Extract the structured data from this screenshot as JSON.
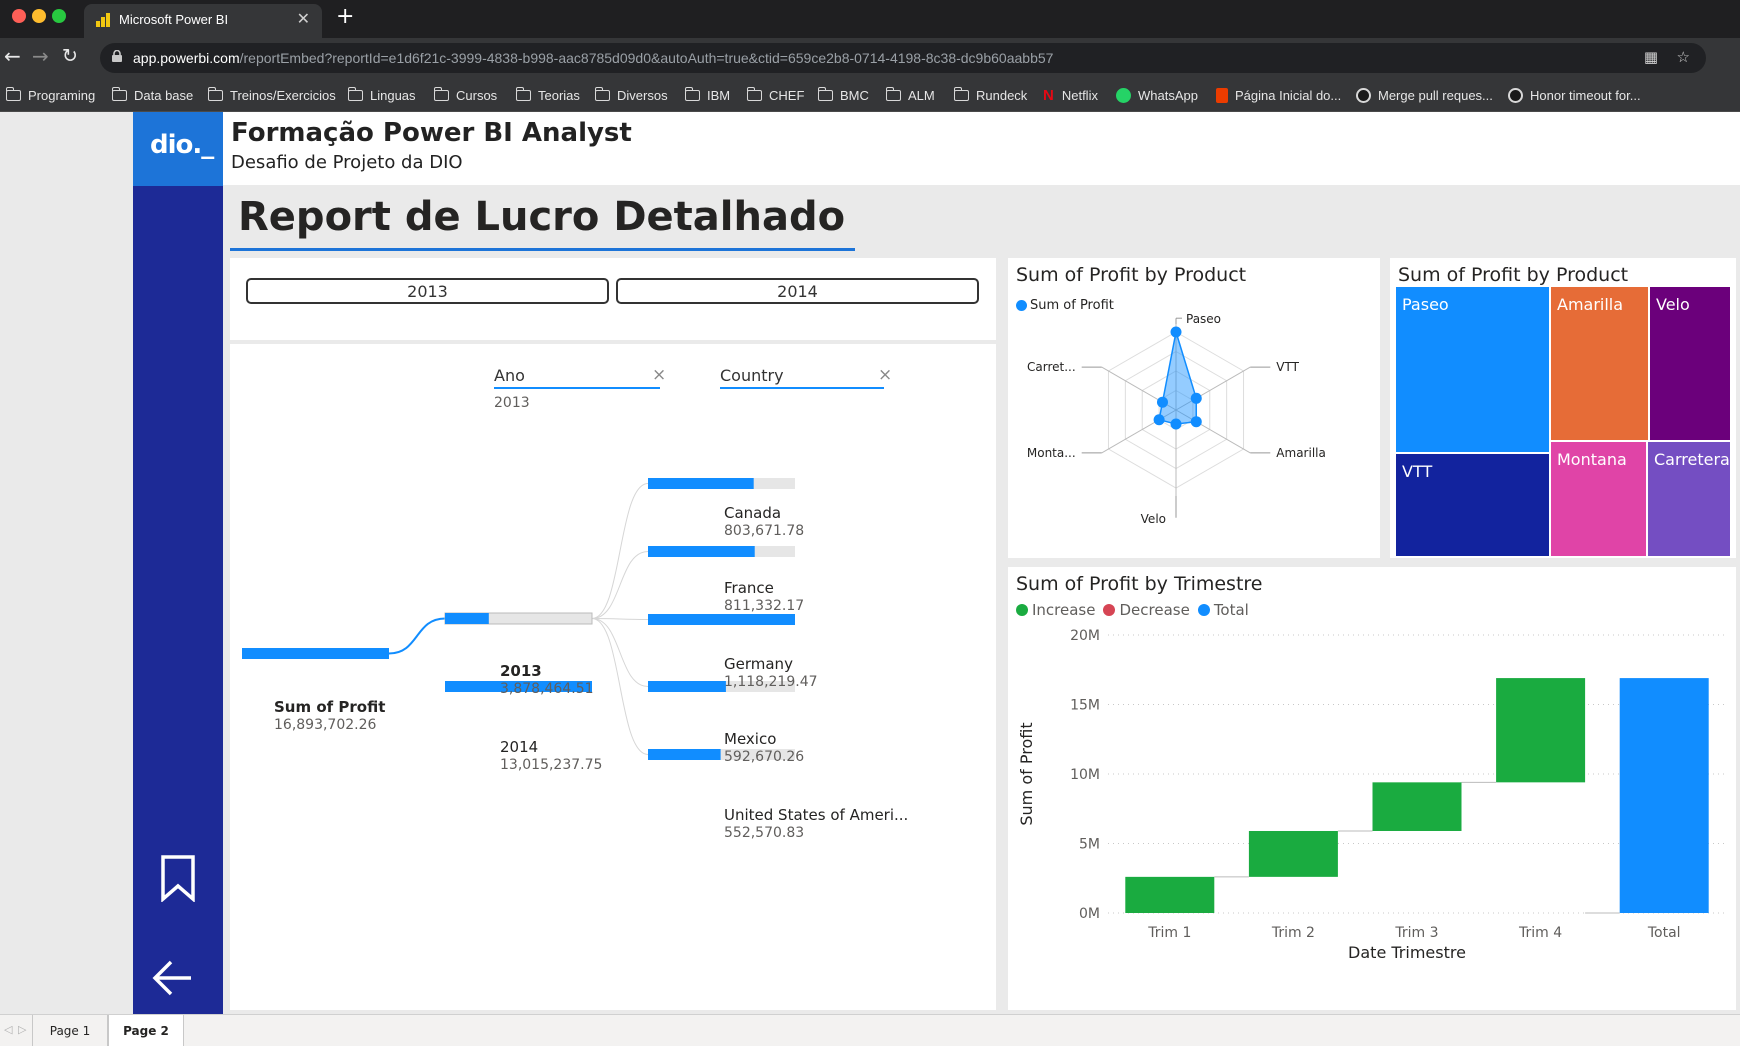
{
  "browser": {
    "tab_title": "Microsoft Power BI",
    "url_host": "app.powerbi.com",
    "url_path": "/reportEmbed?reportId=e1d6f21c-3999-4838-b998-aac8785d09d0&autoAuth=true&ctid=659ce2b8-0714-4198-8c38-dc9b60aabb57",
    "bookmarks": [
      "Programing",
      "Data base",
      "Treinos/Exercicios",
      "Linguas",
      "Cursos",
      "Teorias",
      "Diversos",
      "IBM",
      "CHEF",
      "BMC",
      "ALM",
      "Rundeck",
      "Netflix",
      "WhatsApp",
      "Página Inicial do...",
      "Merge pull reques...",
      "Honor timeout for..."
    ]
  },
  "header": {
    "title": "Formação Power BI Analyst",
    "subtitle": "Desafio de Projeto da DIO",
    "logo": "dio._"
  },
  "report": {
    "title": "Report de Lucro Detalhado"
  },
  "slicer": {
    "years": [
      "2013",
      "2014"
    ]
  },
  "decomposition_tree": {
    "levels": [
      {
        "label": "Ano",
        "selected": "2013"
      },
      {
        "label": "Country",
        "selected": ""
      }
    ],
    "root": {
      "label": "Sum of Profit",
      "value": "16,893,702.26",
      "fraction": 1.0
    },
    "years": [
      {
        "label": "2013",
        "value": "3,878,464.51",
        "fraction": 0.298,
        "selected": true
      },
      {
        "label": "2014",
        "value": "13,015,237.75",
        "fraction": 1.0,
        "selected": false
      }
    ],
    "countries": [
      {
        "label": "Canada",
        "value": "803,671.78",
        "fraction": 0.719
      },
      {
        "label": "France",
        "value": "811,332.17",
        "fraction": 0.726
      },
      {
        "label": "Germany",
        "value": "1,118,219.47",
        "fraction": 1.0
      },
      {
        "label": "Mexico",
        "value": "592,670.26",
        "fraction": 0.53
      },
      {
        "label": "United States of Ameri...",
        "value": "552,570.83",
        "fraction": 0.494
      }
    ]
  },
  "radar": {
    "title": "Sum of Profit by Product",
    "legend": "Sum of Profit",
    "axes": [
      "Paseo",
      "VTT",
      "Amarilla",
      "Velo",
      "Monta...",
      "Carret..."
    ],
    "values": [
      1.0,
      0.3,
      0.3,
      0.18,
      0.25,
      0.2
    ],
    "color": "#118dff"
  },
  "treemap": {
    "title": "Sum of Profit by Product",
    "cells": [
      {
        "label": "Paseo",
        "color": "#118dff"
      },
      {
        "label": "Amarilla",
        "color": "#e66c37"
      },
      {
        "label": "Velo",
        "color": "#6b007b"
      },
      {
        "label": "VTT",
        "color": "#12239e"
      },
      {
        "label": "Montana",
        "color": "#e044a7"
      },
      {
        "label": "Carretera",
        "color": "#744ec2"
      }
    ]
  },
  "chart_data": {
    "type": "waterfall",
    "title": "Sum of Profit by Trimestre",
    "xlabel": "Date Trimestre",
    "ylabel": "Sum of Profit",
    "legend": [
      "Increase",
      "Decrease",
      "Total"
    ],
    "colors": {
      "increase": "#1aab40",
      "decrease": "#d64554",
      "total": "#118dff"
    },
    "categories": [
      "Trim 1",
      "Trim 2",
      "Trim 3",
      "Trim 4",
      "Total"
    ],
    "values": [
      2.6,
      3.3,
      3.5,
      7.5,
      16.9
    ],
    "ylim": [
      0,
      20
    ],
    "yticks": [
      "0M",
      "5M",
      "10M",
      "15M",
      "20M"
    ]
  },
  "pages": [
    "Page 1",
    "Page 2"
  ]
}
